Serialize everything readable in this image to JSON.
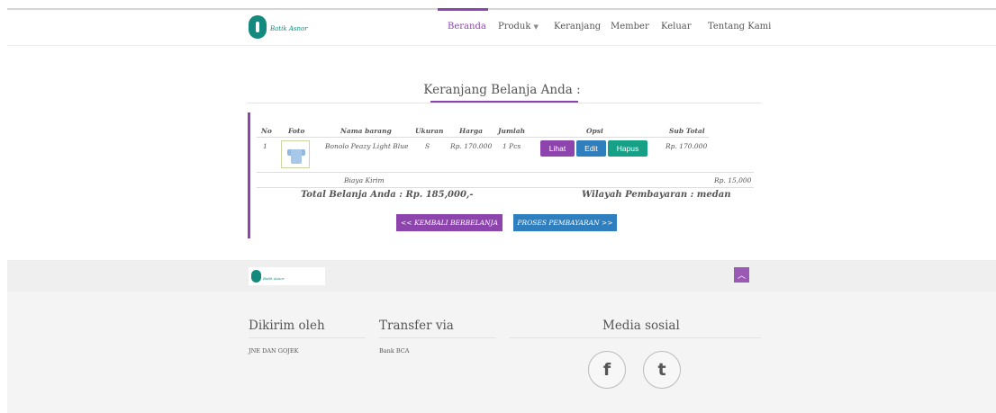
{
  "header": {
    "logo_text": "Batik Asnor",
    "nav": [
      {
        "label": "Beranda",
        "active": true
      },
      {
        "label": "Produk",
        "dropdown": true
      },
      {
        "label": "Keranjang"
      },
      {
        "label": "Member"
      },
      {
        "label": "Keluar"
      },
      {
        "label": "Tentang Kami"
      }
    ]
  },
  "cart": {
    "title": "Keranjang Belanja Anda :",
    "columns": [
      "No",
      "Foto",
      "Nama barang",
      "Ukuran",
      "Harga",
      "Jumlah",
      "Opsi",
      "Sub Total"
    ],
    "rows": [
      {
        "no": "1",
        "thumb_icon": "shirt-icon",
        "name": "Bonolo Peazy Light Blue",
        "size": "S",
        "price": "Rp. 170.000",
        "qty": "1 Pcs",
        "subtotal": "Rp. 170.000",
        "actions": {
          "view": "Lihat",
          "edit": "Edit",
          "delete": "Hapus"
        }
      }
    ],
    "shipping_label": "Biaya Kirim",
    "shipping_value": "Rp. 15,000",
    "total_label": "Total Belanja Anda : Rp. 185,000,-",
    "region_label": "Wilayah Pembayaran : medan",
    "back_button": "<< KEMBALI BERBELANJA",
    "pay_button": "PROSES PEMBAYARAN >>"
  },
  "footer": {
    "logo_text": "Batik Asnor",
    "to_top_icon": "chevron-up-icon",
    "sections": [
      {
        "title": "Dikirim oleh",
        "text": "JNE DAN GOJEK"
      },
      {
        "title": "Transfer via",
        "text": "Bank BCA"
      },
      {
        "title": "Media sosial"
      }
    ],
    "social": [
      {
        "icon": "facebook-icon",
        "glyph": "f"
      },
      {
        "icon": "tumblr-icon",
        "glyph": "t"
      }
    ]
  },
  "colors": {
    "accent": "#8e44ad",
    "primary": "#2f7fbf",
    "success": "#16a085",
    "brand": "#138a7d"
  }
}
